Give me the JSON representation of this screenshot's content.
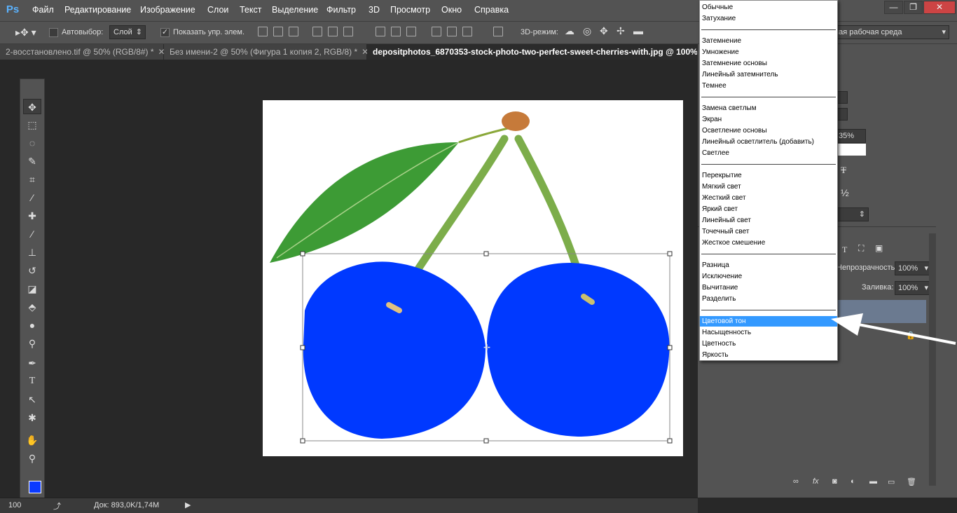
{
  "app": {
    "logo": "Ps"
  },
  "menu": [
    "Файл",
    "Редактирование",
    "Изображение",
    "Слои",
    "Текст",
    "Выделение",
    "Фильтр",
    "3D",
    "Просмотр",
    "Окно",
    "Справка"
  ],
  "window_buttons": {
    "minimize": "—",
    "restore": "❐",
    "close": "✕"
  },
  "options": {
    "autoselect_label": "Автовыбор:",
    "autoselect_value": "Слой",
    "show_controls_label": "Показать упр. элем.",
    "mode3d_label": "3D-режим:",
    "workspace_value": "ная рабочая среда"
  },
  "tabs": [
    {
      "label": "2-восстановлено.tif @ 50% (RGB/8#) *",
      "close": "✕"
    },
    {
      "label": "Без имени-2 @ 50% (Фигура 1 копия 2, RGB/8) *",
      "close": "✕"
    },
    {
      "label": "depositphotos_6870353-stock-photo-two-perfect-sweet-cherries-with.jpg @ 100% (Слой"
    }
  ],
  "status": {
    "zoom": "100",
    "doc": "Док: 893,0K/1,74M"
  },
  "blend_modes": {
    "g1": [
      "Обычные",
      "Затухание"
    ],
    "g2": [
      "Затемнение",
      "Умножение",
      "Затемнение основы",
      "Линейный затемнитель",
      "Темнее"
    ],
    "g3": [
      "Замена светлым",
      "Экран",
      "Осветление основы",
      "Линейный осветлитель (добавить)",
      "Светлее"
    ],
    "g4": [
      "Перекрытие",
      "Мягкий свет",
      "Жесткий свет",
      "Яркий свет",
      "Линейный свет",
      "Точечный свет",
      "Жесткое смешение"
    ],
    "g5": [
      "Разница",
      "Исключение",
      "Вычитание",
      "Разделить"
    ],
    "g6": [
      "Цветовой тон",
      "Насыщенность",
      "Цветность",
      "Яркость"
    ],
    "selected": "Цветовой тон"
  },
  "layers_panel": {
    "opacity_label": "Непрозрачность:",
    "opacity_value": "100%",
    "fill_label": "Заливка:",
    "fill_value": "100%",
    "partial_value": "35%",
    "half_glyph": "½",
    "type_glyph": "T"
  },
  "colors": {
    "accent": "#3399ff",
    "foreground": "#0a3aff",
    "background": "#ffffff",
    "cherry": "#0039ff"
  }
}
